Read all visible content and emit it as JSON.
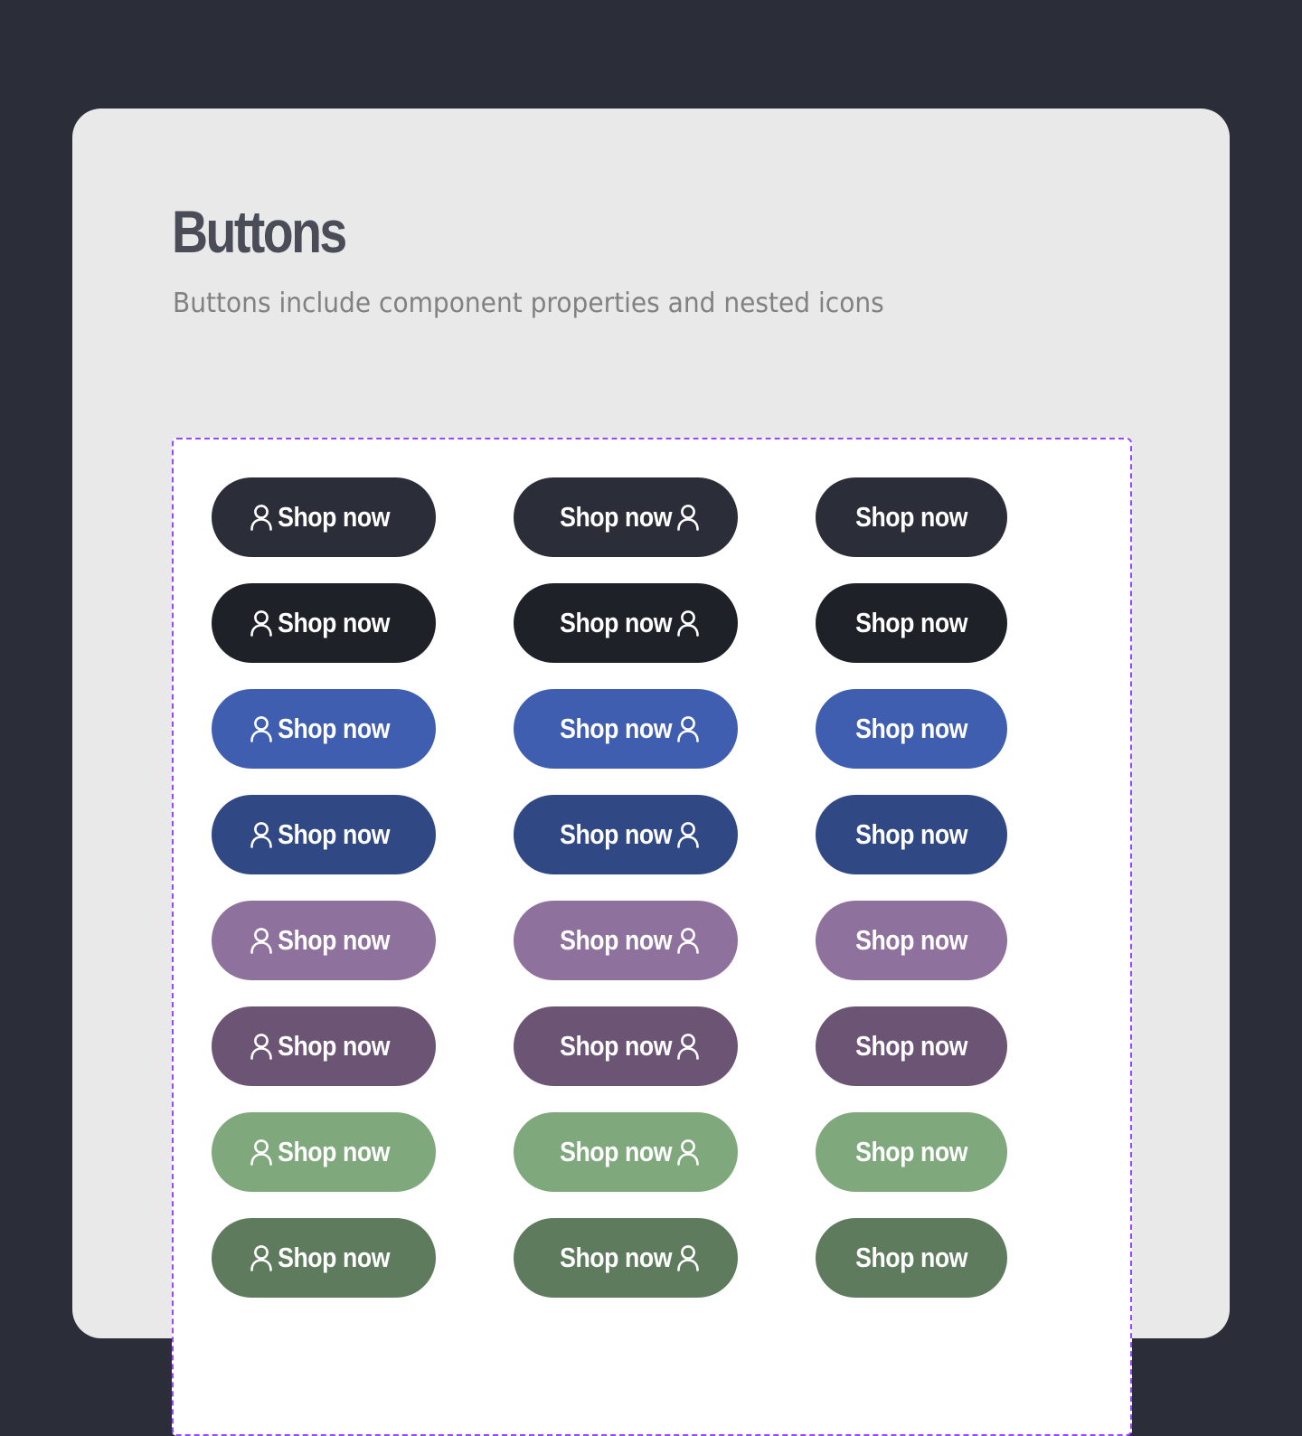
{
  "header": {
    "title": "Buttons",
    "subtitle": "Buttons include component properties and nested icons"
  },
  "icons": {
    "button_icon": "user-icon"
  },
  "button_label": "Shop now",
  "variants": [
    {
      "name": "dark",
      "color": "#2b2e39"
    },
    {
      "name": "dark-pressed",
      "color": "#1f2129"
    },
    {
      "name": "blue",
      "color": "#405eb0"
    },
    {
      "name": "blue-pressed",
      "color": "#304884"
    },
    {
      "name": "purple",
      "color": "#8e719d"
    },
    {
      "name": "purple-pressed",
      "color": "#6c5475"
    },
    {
      "name": "green",
      "color": "#80a87d"
    },
    {
      "name": "green-pressed",
      "color": "#5e7b5d"
    }
  ],
  "columns": [
    {
      "icon_position": "left"
    },
    {
      "icon_position": "right"
    },
    {
      "icon_position": "none"
    }
  ]
}
